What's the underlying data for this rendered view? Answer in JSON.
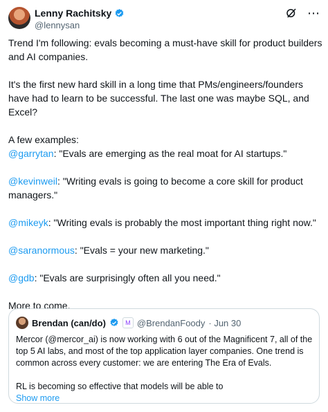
{
  "author": {
    "name": "Lenny Rachitsky",
    "handle": "@lennysan"
  },
  "body": {
    "p1": "Trend I'm following: evals becoming a must-have skill for product builders and AI companies.",
    "p2": "It's the first new hard skill in a long time that PMs/engineers/founders have had to learn to be successful. The last one was maybe SQL, and Excel?",
    "p3": "A few examples:",
    "quotes": [
      {
        "mention": "@garrytan",
        "text": ": \"Evals are emerging as the real moat for AI startups.\""
      },
      {
        "mention": "@kevinweil",
        "text": ": \"Writing evals is going to become a core skill for product managers.\""
      },
      {
        "mention": "@mikeyk",
        "text": ": \"Writing evals is probably the most important thing right now.\""
      },
      {
        "mention": "@saranormous",
        "text": ": \"Evals = your new marketing.\""
      },
      {
        "mention": "@gdb",
        "text": ": \"Evals are surprisingly often all you need.\""
      }
    ],
    "closing": "More to come."
  },
  "quoted": {
    "name": "Brendan (can/do)",
    "handle": "@BrendanFoody",
    "date": "· Jun 30",
    "p1": "Mercor (@mercor_ai) is now working with 6 out of the Magnificent 7, all of the top 5 AI labs, and most of the top application layer companies. One trend is common across every customer: we are entering The Era of Evals.",
    "p2": "RL is becoming so effective that models will be able to",
    "show_more": "Show more"
  },
  "icons": {
    "verified": "verified-badge-icon",
    "grok": "grok-icon",
    "more": "more-icon"
  },
  "colors": {
    "accent": "#1d9bf0",
    "text": "#0f1419",
    "muted": "#536471",
    "border": "#cfd9de"
  }
}
